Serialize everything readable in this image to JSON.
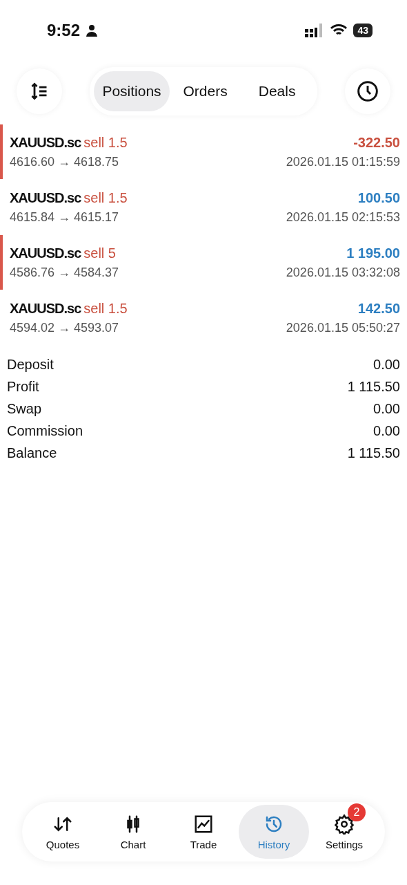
{
  "status_bar": {
    "time": "9:52",
    "battery": "43"
  },
  "toolbar": {
    "tabs": [
      {
        "label": "Positions",
        "selected": true
      },
      {
        "label": "Orders",
        "selected": false
      },
      {
        "label": "Deals",
        "selected": false
      }
    ]
  },
  "deals": [
    {
      "symbol": "XAUUSD.sc",
      "side": "sell 1.5",
      "prices": "4616.60 → 4618.75",
      "result": "-322.50",
      "kind": "loss",
      "marked": true,
      "time": "2026.01.15 01:15:59"
    },
    {
      "symbol": "XAUUSD.sc",
      "side": "sell 1.5",
      "prices": "4615.84 → 4615.17",
      "result": "100.50",
      "kind": "profit",
      "marked": false,
      "time": "2026.01.15 02:15:53"
    },
    {
      "symbol": "XAUUSD.sc",
      "side": "sell 5",
      "prices": "4586.76 → 4584.37",
      "result": "1 195.00",
      "kind": "profit",
      "marked": true,
      "time": "2026.01.15 03:32:08"
    },
    {
      "symbol": "XAUUSD.sc",
      "side": "sell 1.5",
      "prices": "4594.02 → 4593.07",
      "result": "142.50",
      "kind": "profit",
      "marked": false,
      "time": "2026.01.15 05:50:27"
    }
  ],
  "summary": [
    {
      "label": "Deposit",
      "value": "0.00"
    },
    {
      "label": "Profit",
      "value": "1 115.50"
    },
    {
      "label": "Swap",
      "value": "0.00"
    },
    {
      "label": "Commission",
      "value": "0.00"
    },
    {
      "label": "Balance",
      "value": "1 115.50"
    }
  ],
  "bottom_nav": [
    {
      "label": "Quotes",
      "kind": "quotes",
      "selected": false
    },
    {
      "label": "Chart",
      "kind": "chart",
      "selected": false
    },
    {
      "label": "Trade",
      "kind": "trade",
      "selected": false
    },
    {
      "label": "History",
      "kind": "history",
      "selected": true
    },
    {
      "label": "Settings",
      "kind": "settings",
      "selected": false,
      "badge": "2"
    }
  ]
}
